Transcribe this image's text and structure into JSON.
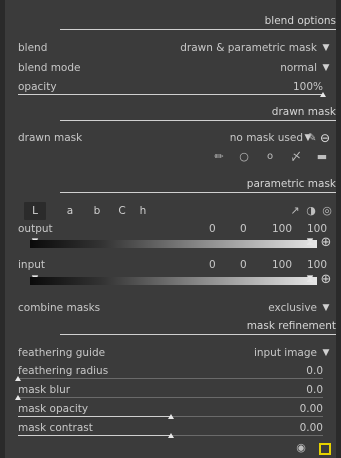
{
  "sections": {
    "blend_options": "blend options",
    "drawn_mask": "drawn mask",
    "parametric_mask": "parametric mask",
    "mask_refinement": "mask refinement"
  },
  "blend": {
    "label": "blend",
    "value": "drawn & parametric mask"
  },
  "blend_mode": {
    "label": "blend mode",
    "value": "normal"
  },
  "opacity": {
    "label": "opacity",
    "value": "100%",
    "level": 1.0
  },
  "drawn_mask_row": {
    "label": "drawn mask",
    "value": "no mask used"
  },
  "channel_tabs": [
    "L",
    "a",
    "b",
    "C",
    "h"
  ],
  "output": {
    "label": "output",
    "values": [
      "0",
      "0",
      "100",
      "100"
    ]
  },
  "input": {
    "label": "input",
    "values": [
      "0",
      "0",
      "100",
      "100"
    ]
  },
  "combine_masks": {
    "label": "combine masks",
    "value": "exclusive"
  },
  "feathering_guide": {
    "label": "feathering guide",
    "value": "input image"
  },
  "feathering_radius": {
    "label": "feathering radius",
    "value": "0.0",
    "level": 0.0
  },
  "mask_blur": {
    "label": "mask blur",
    "value": "0.0",
    "level": 0.0
  },
  "mask_opacity": {
    "label": "mask opacity",
    "value": "0.00",
    "level": 0.5
  },
  "mask_contrast": {
    "label": "mask contrast",
    "value": "0.00",
    "level": 0.5
  },
  "colors": {
    "background": "#3b3b3b",
    "text": "#c8c8c8",
    "accent": "#e6d200"
  },
  "icons": [
    "dropdown-arrow-icon",
    "mask-edit-icon",
    "mask-off-icon",
    "pen-icon",
    "circle-icon",
    "ellipse-icon",
    "path-icon",
    "gradient-icon",
    "picker-icon",
    "invert-icon",
    "reset-icon",
    "color-picker-plus-icon",
    "eye-icon",
    "display-mask-icon"
  ]
}
